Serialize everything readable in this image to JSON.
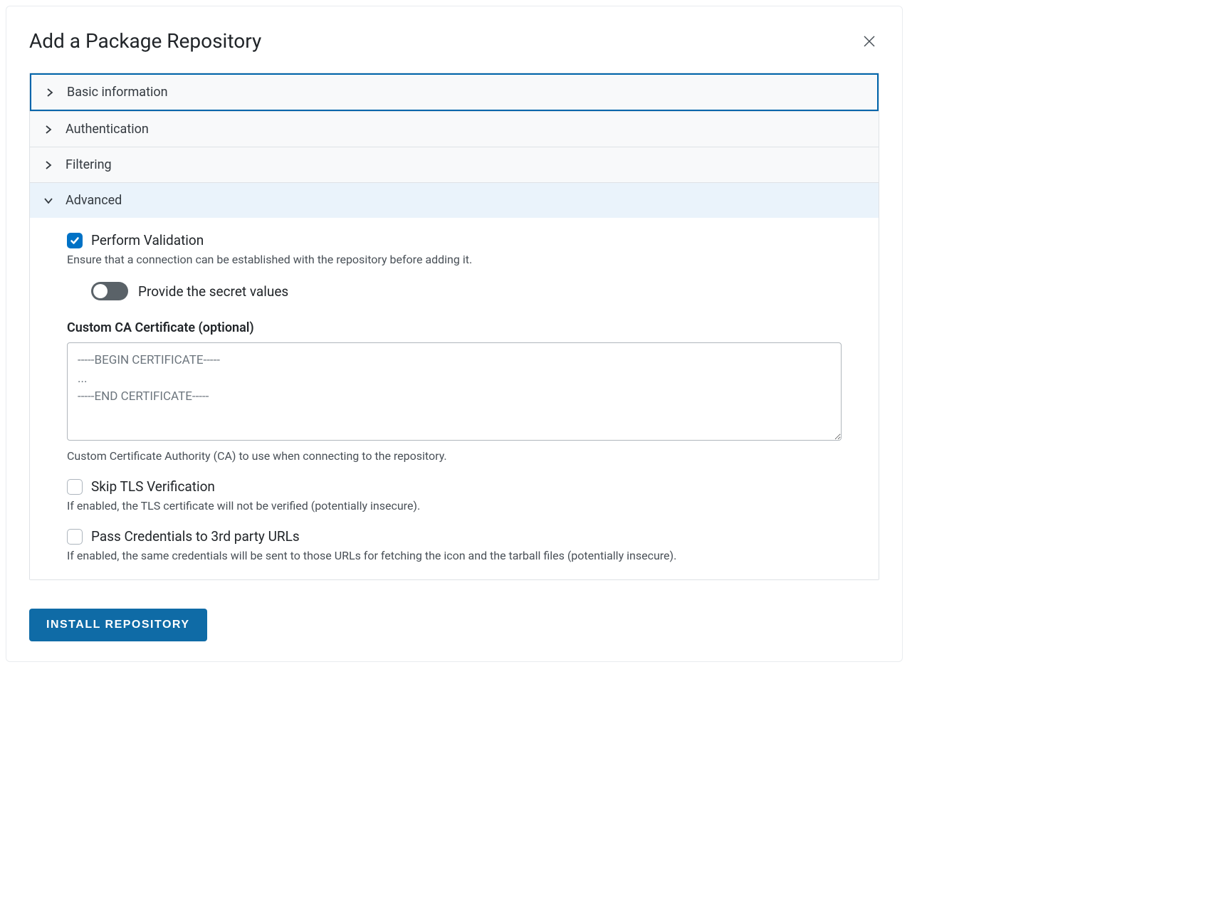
{
  "modal": {
    "title": "Add a Package Repository"
  },
  "accordion": {
    "basic_info": {
      "label": "Basic information"
    },
    "authentication": {
      "label": "Authentication"
    },
    "filtering": {
      "label": "Filtering"
    },
    "advanced": {
      "label": "Advanced"
    }
  },
  "advanced": {
    "perform_validation": {
      "label": "Perform Validation",
      "checked": true,
      "help": "Ensure that a connection can be established with the repository before adding it."
    },
    "provide_secret": {
      "label": "Provide the secret values",
      "enabled": false
    },
    "custom_ca": {
      "label": "Custom CA Certificate (optional)",
      "value": "",
      "placeholder": "-----BEGIN CERTIFICATE-----\n...\n-----END CERTIFICATE-----",
      "help": "Custom Certificate Authority (CA) to use when connecting to the repository."
    },
    "skip_tls": {
      "label": "Skip TLS Verification",
      "checked": false,
      "help": "If enabled, the TLS certificate will not be verified (potentially insecure)."
    },
    "pass_credentials": {
      "label": "Pass Credentials to 3rd party URLs",
      "checked": false,
      "help": "If enabled, the same credentials will be sent to those URLs for fetching the icon and the tarball files (potentially insecure)."
    }
  },
  "actions": {
    "install": "Install Repository"
  }
}
